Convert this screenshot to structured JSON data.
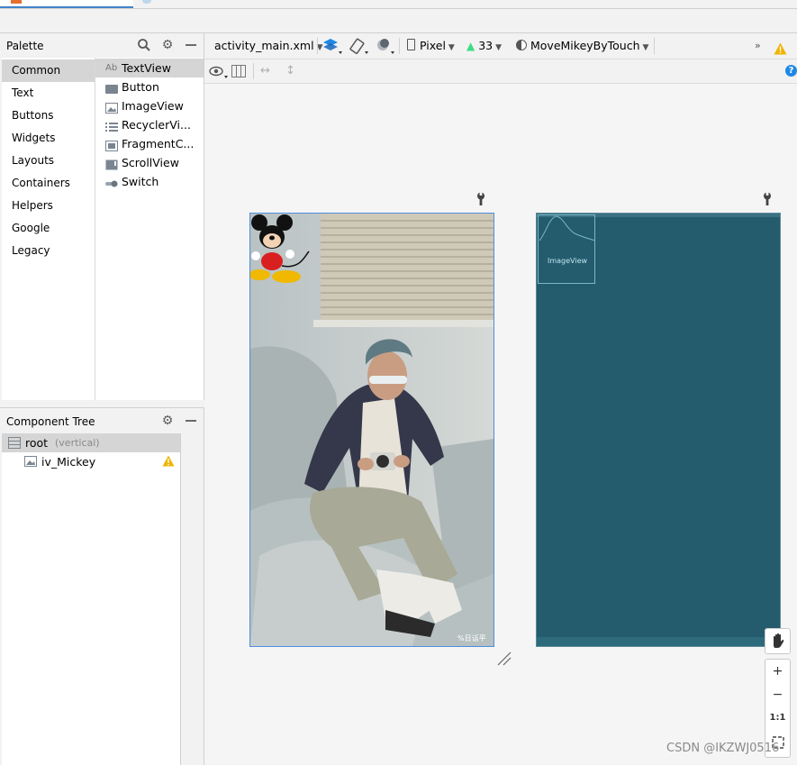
{
  "palette": {
    "title": "Palette",
    "categories": [
      "Common",
      "Text",
      "Buttons",
      "Widgets",
      "Layouts",
      "Containers",
      "Helpers",
      "Google",
      "Legacy"
    ],
    "selected_category": "Common",
    "items": [
      {
        "label": "TextView",
        "icon": "textview-icon",
        "icon_text": "Ab"
      },
      {
        "label": "Button",
        "icon": "button-icon"
      },
      {
        "label": "ImageView",
        "icon": "imageview-icon"
      },
      {
        "label": "RecyclerVi...",
        "icon": "recyclerview-icon"
      },
      {
        "label": "FragmentC...",
        "icon": "fragment-icon"
      },
      {
        "label": "ScrollView",
        "icon": "scrollview-icon"
      },
      {
        "label": "Switch",
        "icon": "switch-icon"
      }
    ]
  },
  "component_tree": {
    "title": "Component Tree",
    "root": {
      "label": "root",
      "hint": "(vertical)"
    },
    "child": {
      "label": "iv_Mickey",
      "warning": true
    }
  },
  "editor_toolbar": {
    "file": "activity_main.xml",
    "device": "Pixel",
    "api": "33",
    "theme": "MoveMikeyByTouch",
    "overflow": "»"
  },
  "blueprint": {
    "image_label": "ImageView"
  },
  "zoom": {
    "zoom_in": "+",
    "zoom_out": "−",
    "one_to_one": "1:1"
  },
  "watermark": "CSDN @IKZWJ0516",
  "photo_watermark": "%日话平",
  "colors": {
    "blueprint_bg": "#245c6e",
    "selection_blue": "#4e8de0",
    "warning": "#f0b400",
    "accent_blue": "#1e88e5"
  }
}
